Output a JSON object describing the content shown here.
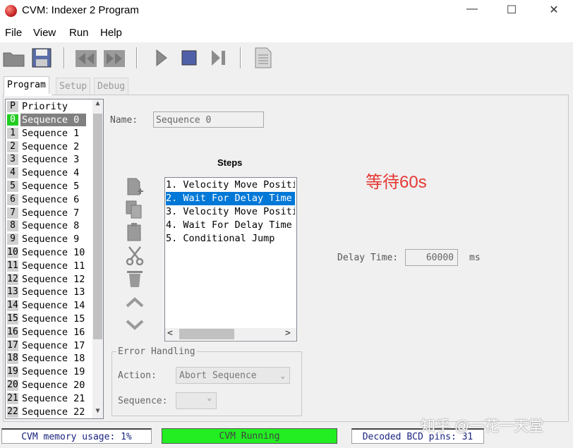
{
  "window": {
    "title": "CVM: Indexer 2 Program",
    "minimize": "—",
    "maximize": "☐",
    "close": "✕"
  },
  "menu": [
    "File",
    "View",
    "Run",
    "Help"
  ],
  "tabs": [
    "Program",
    "Setup",
    "Debug"
  ],
  "sequence_list": {
    "header_tag": "P",
    "header_label": "Priority",
    "selected_index": 0,
    "items": [
      {
        "num": "0",
        "label": "Sequence 0"
      },
      {
        "num": "1",
        "label": "Sequence 1"
      },
      {
        "num": "2",
        "label": "Sequence 2"
      },
      {
        "num": "3",
        "label": "Sequence 3"
      },
      {
        "num": "4",
        "label": "Sequence 4"
      },
      {
        "num": "5",
        "label": "Sequence 5"
      },
      {
        "num": "6",
        "label": "Sequence 6"
      },
      {
        "num": "7",
        "label": "Sequence 7"
      },
      {
        "num": "8",
        "label": "Sequence 8"
      },
      {
        "num": "9",
        "label": "Sequence 9"
      },
      {
        "num": "10",
        "label": "Sequence 10"
      },
      {
        "num": "11",
        "label": "Sequence 11"
      },
      {
        "num": "12",
        "label": "Sequence 12"
      },
      {
        "num": "13",
        "label": "Sequence 13"
      },
      {
        "num": "14",
        "label": "Sequence 14"
      },
      {
        "num": "15",
        "label": "Sequence 15"
      },
      {
        "num": "16",
        "label": "Sequence 16"
      },
      {
        "num": "17",
        "label": "Sequence 17"
      },
      {
        "num": "18",
        "label": "Sequence 18"
      },
      {
        "num": "19",
        "label": "Sequence 19"
      },
      {
        "num": "20",
        "label": "Sequence 20"
      },
      {
        "num": "21",
        "label": "Sequence 21"
      },
      {
        "num": "22",
        "label": "Sequence 22"
      }
    ]
  },
  "name": {
    "label": "Name:",
    "value": "Sequence 0"
  },
  "steps": {
    "title": "Steps",
    "selected_index": 1,
    "items": [
      "1. Velocity Move Positi",
      "2. Wait For Delay Time",
      "3. Velocity Move Positi",
      "4. Wait For Delay Time",
      "5. Conditional Jump"
    ]
  },
  "annotation": "等待60s",
  "delay": {
    "label": "Delay Time:",
    "value": "60000",
    "unit": "ms"
  },
  "error_handling": {
    "legend": "Error Handling",
    "action_label": "Action:",
    "action_value": "Abort Sequence",
    "sequence_label": "Sequence:",
    "sequence_value": ""
  },
  "status": {
    "memory": "CVM memory usage: 1%",
    "running": "CVM Running",
    "bcd": "Decoded BCD pins: 31"
  },
  "watermark": "知乎 @一花一天堂",
  "colors": {
    "running_bg": "#22ee22",
    "selection": "#0078d7",
    "priority_selected": "#22cc22",
    "annotation": "#e53935"
  }
}
